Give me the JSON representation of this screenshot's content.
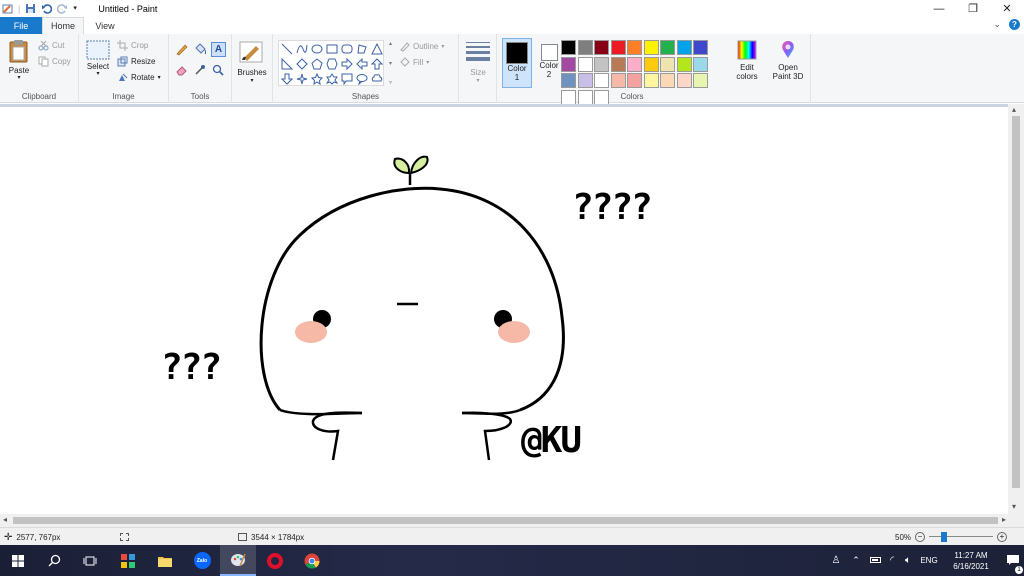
{
  "window": {
    "title": "Untitled - Paint",
    "minimize_icon": "minimize-icon",
    "restore_icon": "restore-icon",
    "close_icon": "close-icon"
  },
  "tabs": [
    {
      "label": "File"
    },
    {
      "label": "Home"
    },
    {
      "label": "View"
    }
  ],
  "ribbon": {
    "clipboard": {
      "label": "Clipboard",
      "paste": "Paste",
      "cut": "Cut",
      "copy": "Copy"
    },
    "image": {
      "label": "Image",
      "select": "Select",
      "crop": "Crop",
      "resize": "Resize",
      "rotate": "Rotate"
    },
    "tools": {
      "label": "Tools"
    },
    "brushes": {
      "label": "Brushes"
    },
    "shapes": {
      "label": "Shapes",
      "outline": "Outline",
      "fill": "Fill"
    },
    "size": {
      "label": "Size"
    },
    "colors": {
      "label": "Colors",
      "color1_label": "Color",
      "color1_num": "1",
      "color2_label": "Color",
      "color2_num": "2",
      "color1_value": "#000000",
      "color2_value": "#ffffff",
      "edit_colors_line1": "Edit",
      "edit_colors_line2": "colors",
      "open_paint3d_line1": "Open",
      "open_paint3d_line2": "Paint 3D",
      "palette": [
        "#000000",
        "#7f7f7f",
        "#880015",
        "#ed1c24",
        "#ff7f27",
        "#fff200",
        "#22b14c",
        "#00a2e8",
        "#3f48cc",
        "#a349a4",
        "#ffffff",
        "#c3c3c3",
        "#b97a57",
        "#ffaec9",
        "#ffc90e",
        "#efe4b0",
        "#b5e61d",
        "#99d9ea",
        "#7092be",
        "#c8bfe7",
        "#ffffff",
        "#f6b9a8",
        "#f4a1a0",
        "#fff5a0",
        "#fbd9b6",
        "#fcd6c8",
        "#e8f5b0",
        "#ffffff",
        "#ffffff",
        "#ffffff"
      ]
    }
  },
  "canvas": {
    "text_left": "???",
    "text_right": "????",
    "signature": "@KU",
    "sprout_color": "#d6eea0",
    "blush_color": "#f6b9a8"
  },
  "status": {
    "cursor_pos": "2577, 767px",
    "image_size": "3544 × 1784px",
    "zoom": "50%"
  },
  "taskbar": {
    "language": "ENG",
    "time": "11:27 AM",
    "date": "6/16/2021",
    "notification_count": "1",
    "zalo_label": "Zalo"
  }
}
